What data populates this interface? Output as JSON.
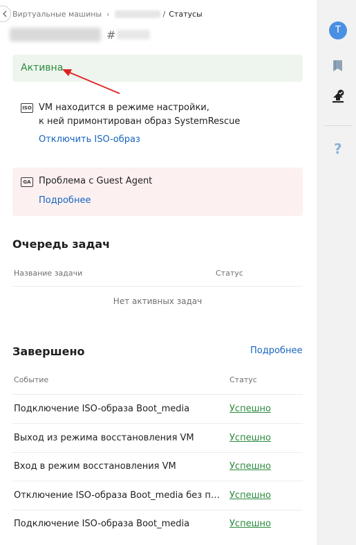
{
  "breadcrumb": {
    "root": "Виртуальные машины",
    "current": "Статусы"
  },
  "vm": {
    "hash": "#"
  },
  "status": {
    "label": "Активна",
    "color": "#2b8a3e"
  },
  "iso_notice": {
    "badge": "ISO",
    "line1": "VM находится в режиме настройки,",
    "line2": "к ней примонтирован образ SystemRescue",
    "action": "Отключить ISO-образ"
  },
  "guest_agent": {
    "badge": "GA",
    "text": "Проблема с Guest Agent",
    "action": "Подробнее"
  },
  "queue": {
    "title": "Очередь задач",
    "col_name": "Название задачи",
    "col_status": "Статус",
    "empty": "Нет активных задач"
  },
  "completed": {
    "title": "Завершено",
    "more": "Подробнее",
    "col_event": "Событие",
    "col_status": "Статус",
    "rows": [
      {
        "event": "Подключение ISO-образа Boot_media",
        "status": "Успешно"
      },
      {
        "event": "Выход из режима восстановления VM",
        "status": "Успешно"
      },
      {
        "event": "Вход в режим восстановления VM",
        "status": "Успешно"
      },
      {
        "event": "Отключение ISO-образа Boot_media без перезагрузки",
        "status": "Успешно"
      },
      {
        "event": "Подключение ISO-образа Boot_media",
        "status": "Успешно"
      }
    ]
  },
  "rail": {
    "avatar": "T",
    "icons": [
      "bookmark-icon",
      "upload-check-icon",
      "help-icon"
    ]
  },
  "colors": {
    "link": "#1565c0",
    "success": "#2b8a3e",
    "warning_bg": "#fcf0f1",
    "success_bg": "#eef5ee",
    "arrow": "#e02020"
  }
}
